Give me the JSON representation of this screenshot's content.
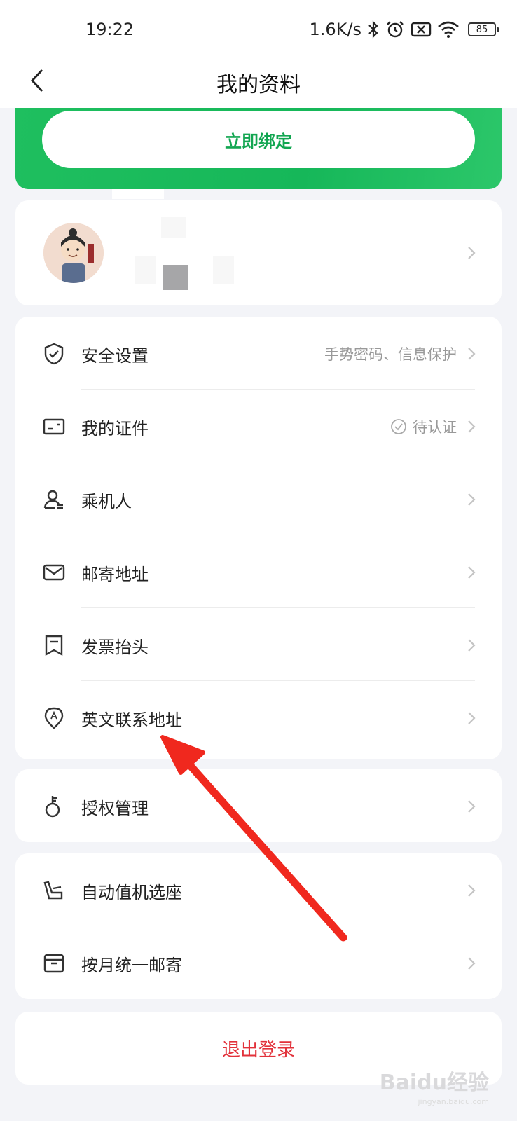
{
  "status_bar": {
    "time": "19:22",
    "network_speed": "1.6K/s",
    "battery": "85"
  },
  "header": {
    "title": "我的资料"
  },
  "bind_card": {
    "button_label": "立即绑定"
  },
  "menu_group_1": [
    {
      "label": "安全设置",
      "value": "手势密码、信息保护",
      "icon": "shield-icon"
    },
    {
      "label": "我的证件",
      "value": "待认证",
      "icon": "id-card-icon"
    },
    {
      "label": "乘机人",
      "value": "",
      "icon": "passenger-icon"
    },
    {
      "label": "邮寄地址",
      "value": "",
      "icon": "mail-icon"
    },
    {
      "label": "发票抬头",
      "value": "",
      "icon": "invoice-icon"
    },
    {
      "label": "英文联系地址",
      "value": "",
      "icon": "location-icon"
    }
  ],
  "menu_group_2": [
    {
      "label": "授权管理",
      "icon": "key-icon"
    }
  ],
  "menu_group_3": [
    {
      "label": "自动值机选座",
      "icon": "seat-icon"
    },
    {
      "label": "按月统一邮寄",
      "icon": "box-icon"
    }
  ],
  "logout": {
    "label": "退出登录"
  },
  "watermark": {
    "text": "Baidu经验",
    "sub": "jingyan.baidu.com"
  },
  "colors": {
    "brand_green": "#16b759",
    "logout_red": "#e2313a",
    "annotation_red": "#f0281e"
  }
}
